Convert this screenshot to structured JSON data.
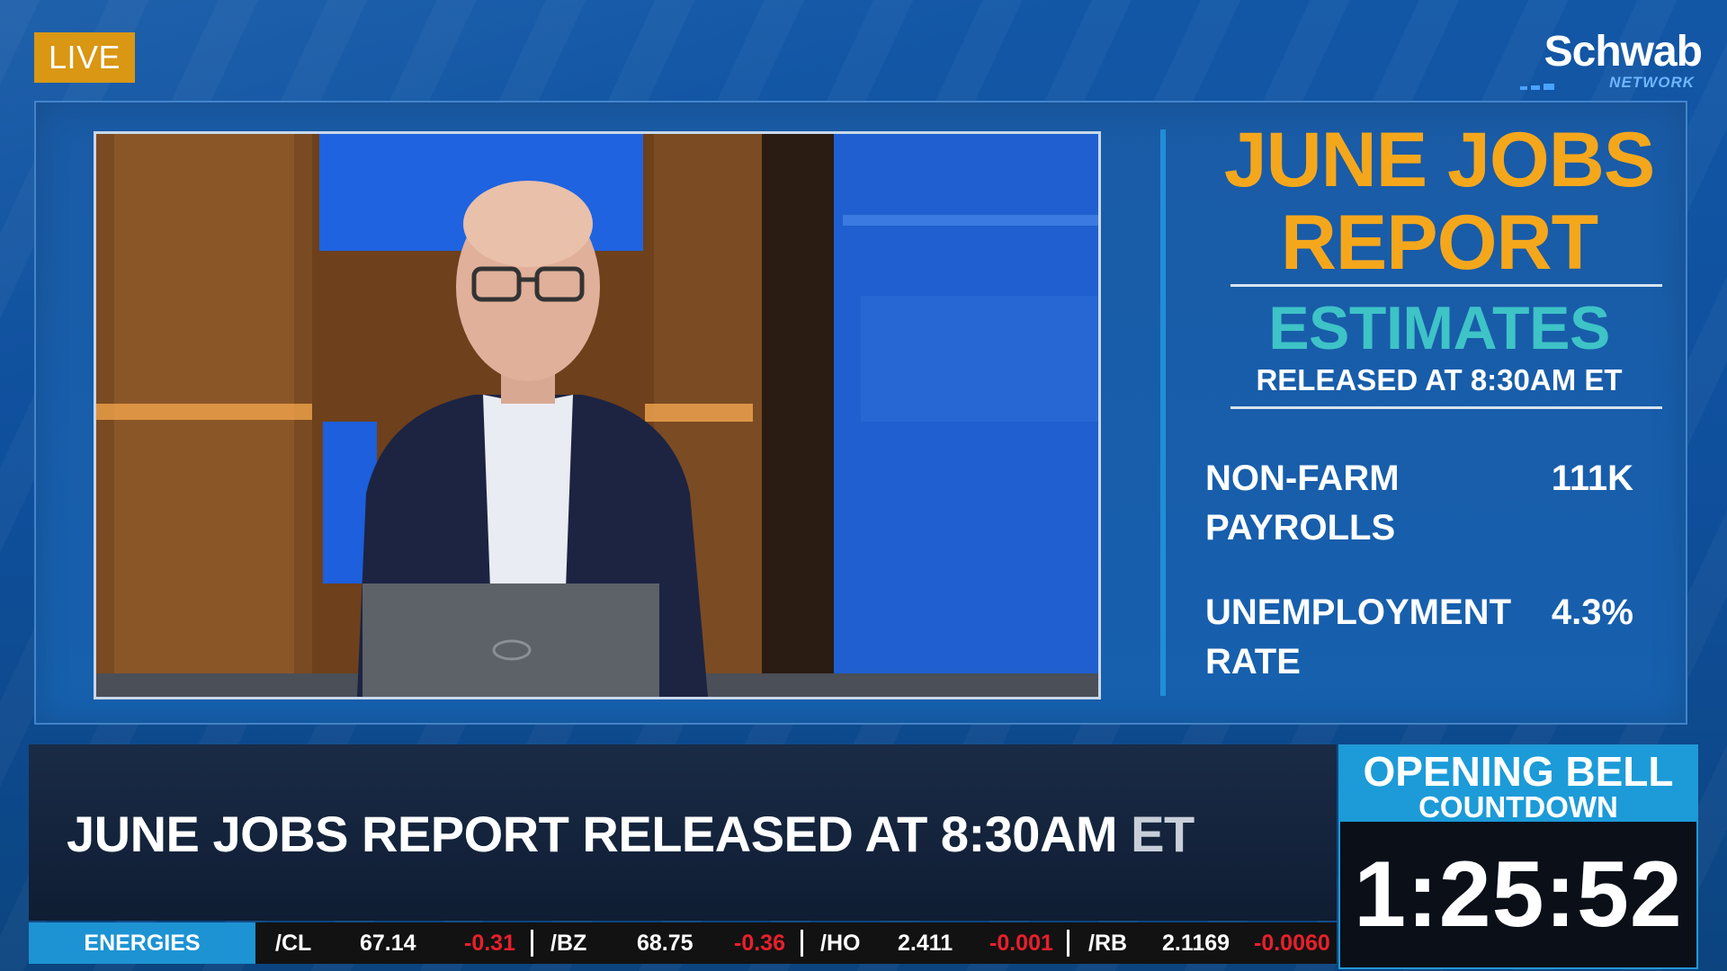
{
  "badge": {
    "live": "LIVE"
  },
  "logo": {
    "brand": "Schwab",
    "sub": "NETWORK"
  },
  "panel": {
    "title_line1": "JUNE JOBS",
    "title_line2": "REPORT",
    "subtitle": "ESTIMATES",
    "release": "RELEASED AT 8:30AM ET",
    "metrics": [
      {
        "label_line1": "NON-FARM",
        "label_line2": "PAYROLLS",
        "value": "111K"
      },
      {
        "label_line1": "UNEMPLOYMENT",
        "label_line2": "RATE",
        "value": "4.3%"
      }
    ]
  },
  "lower_third": {
    "headline_main": "JUNE JOBS REPORT RELEASED AT 8:30AM",
    "headline_tail": "ET"
  },
  "countdown": {
    "line1": "OPENING BELL",
    "line2": "COUNTDOWN",
    "time": "1:25:52"
  },
  "ticker": {
    "category": "ENERGIES",
    "items": [
      {
        "symbol": "/CL",
        "price": "67.14",
        "change": "-0.31"
      },
      {
        "symbol": "/BZ",
        "price": "68.75",
        "change": "-0.36"
      },
      {
        "symbol": "/HO",
        "price": "2.411",
        "change": "-0.001"
      },
      {
        "symbol": "/RB",
        "price": "2.1169",
        "change": "-0.0060"
      }
    ]
  },
  "colors": {
    "live_badge": "#d99713",
    "title_orange": "#f5a71c",
    "subtitle_teal": "#3ec3c7",
    "accent_blue": "#1c9bd8",
    "negative_red": "#e8202c"
  }
}
